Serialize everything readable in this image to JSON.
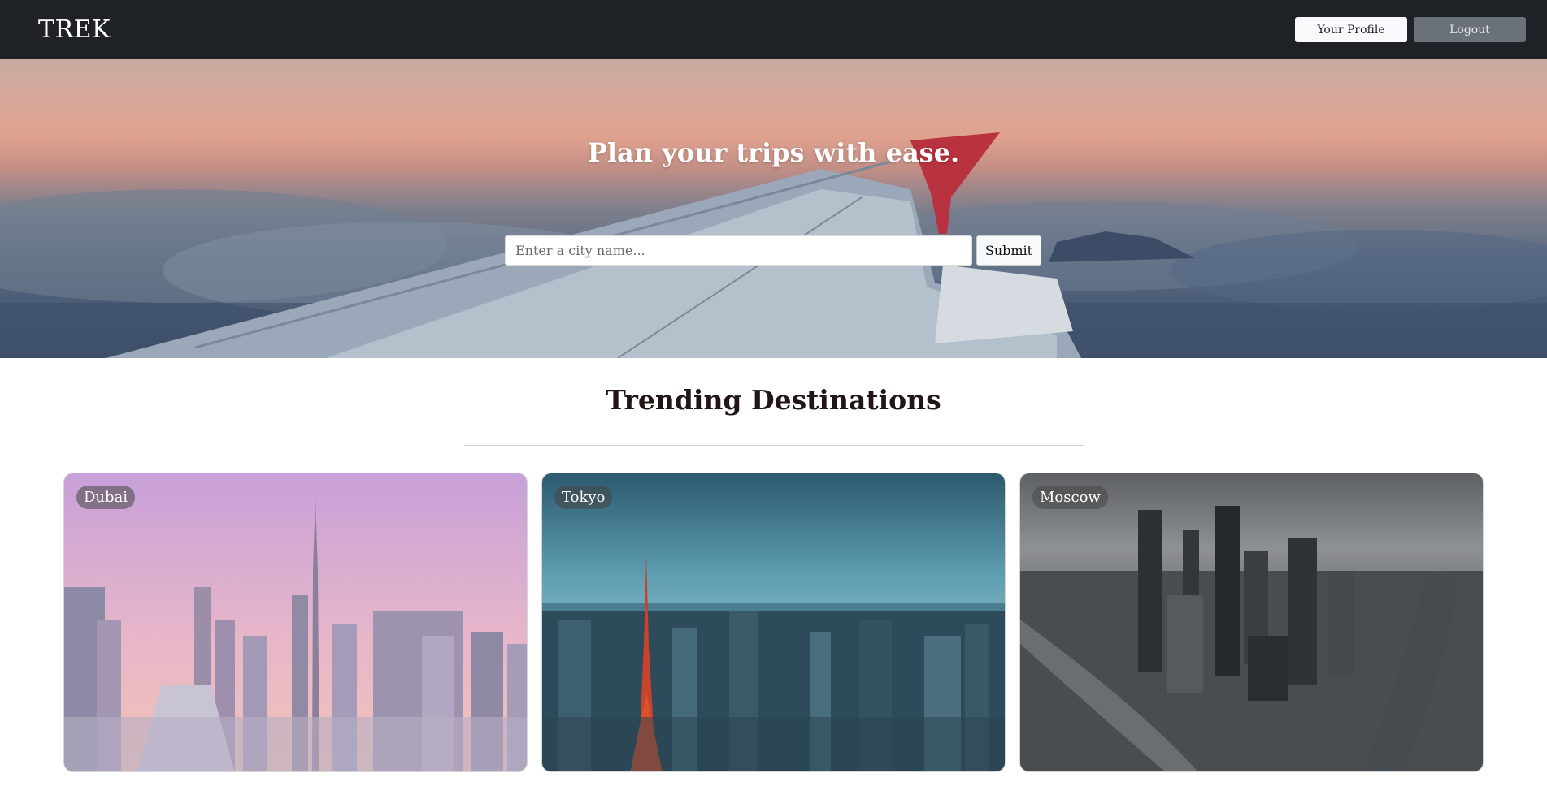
{
  "navbar": {
    "brand": "TREK",
    "profile_label": "Your Profile",
    "logout_label": "Logout"
  },
  "hero": {
    "title": "Plan your trips with ease.",
    "search_placeholder": "Enter a city name...",
    "search_value": "",
    "submit_label": "Submit"
  },
  "trending": {
    "title": "Trending Destinations",
    "cards": [
      {
        "city": "Dubai"
      },
      {
        "city": "Tokyo"
      },
      {
        "city": "Moscow"
      }
    ]
  },
  "colors": {
    "navbar_bg": "#1e2126",
    "logout_bg": "#6b7178",
    "profile_bg": "#f8f9fa"
  }
}
